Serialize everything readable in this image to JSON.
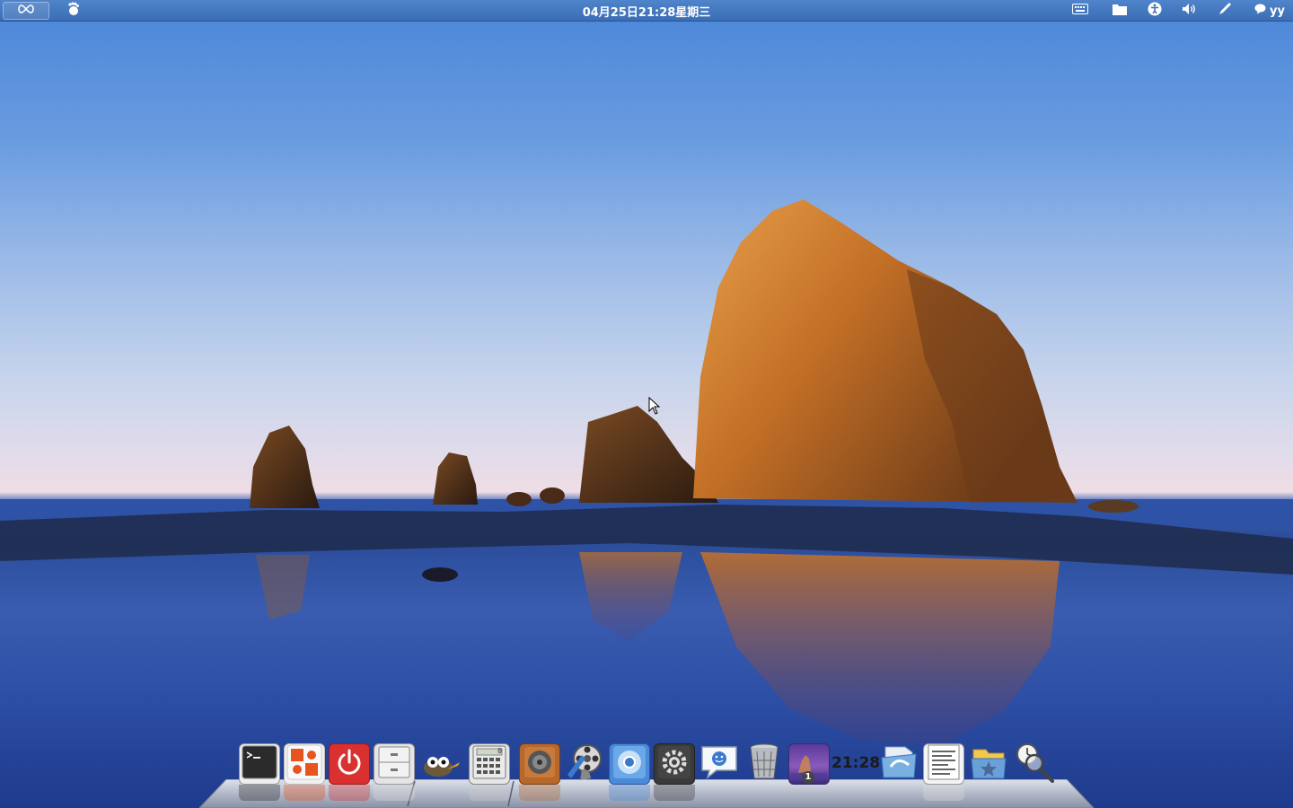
{
  "top_panel": {
    "clock": "04月25日21:28星期三",
    "user": "yy",
    "icons": {
      "apps": "infinity-icon",
      "gnome": "gnome-foot-icon",
      "keyboard": "keyboard-icon",
      "files": "folder-icon",
      "accessibility": "accessibility-icon",
      "sound": "volume-icon",
      "pen": "pen-icon",
      "chat": "chat-bubble-icon"
    }
  },
  "dock": {
    "clock": "21:28",
    "workspace_badge": "1",
    "calculator_display": "0",
    "items": [
      "terminal-icon",
      "system-tools-icon",
      "power-icon",
      "file-cabinet-icon",
      "gimp-icon",
      "calculator-icon",
      "music-speaker-icon",
      "media-player-icon",
      "chromium-browser-icon",
      "settings-gear-icon",
      "chat-messenger-icon",
      "trash-icon",
      "workspace-switcher-icon",
      "clock-applet",
      "documents-folder-icon",
      "text-document-icon",
      "favorites-folder-icon",
      "search-magnifier-icon"
    ]
  },
  "colors": {
    "panel": "#3a6db5",
    "sky": "#4a86d8",
    "sea": "#2a4c9a",
    "rock": "#c87a2e"
  }
}
